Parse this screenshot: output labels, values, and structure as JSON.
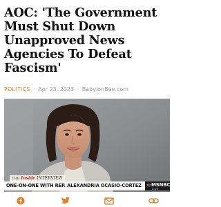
{
  "article": {
    "headline": "AOC: 'The Government Must Shut Down Unapproved News Agencies To Defeat Fascism'",
    "category": "POLITICS",
    "separator": "·",
    "date": "Apr 23, 2023",
    "source": "BabylonBee.com"
  },
  "video": {
    "show_the": "THE",
    "show_script": "Inside",
    "show_rest": "INTERVIEW",
    "caption": "ONE-ON-ONE WITH REP. ALEXANDRIA OCASIO-CORTEZ",
    "network": "MSNBC",
    "network_tag": "LIVE"
  },
  "share_bar": {
    "buttons": [
      {
        "icon": "facebook-icon",
        "color": "#e2802a"
      },
      {
        "icon": "twitter-icon",
        "color": "#e2802a"
      },
      {
        "icon": "email-icon",
        "color": "#e2802a"
      },
      {
        "icon": "link-icon",
        "color": "#e2802a"
      }
    ]
  },
  "colors": {
    "accent": "#e2802a",
    "headline": "#111111",
    "meta": "#9a9a9a"
  }
}
